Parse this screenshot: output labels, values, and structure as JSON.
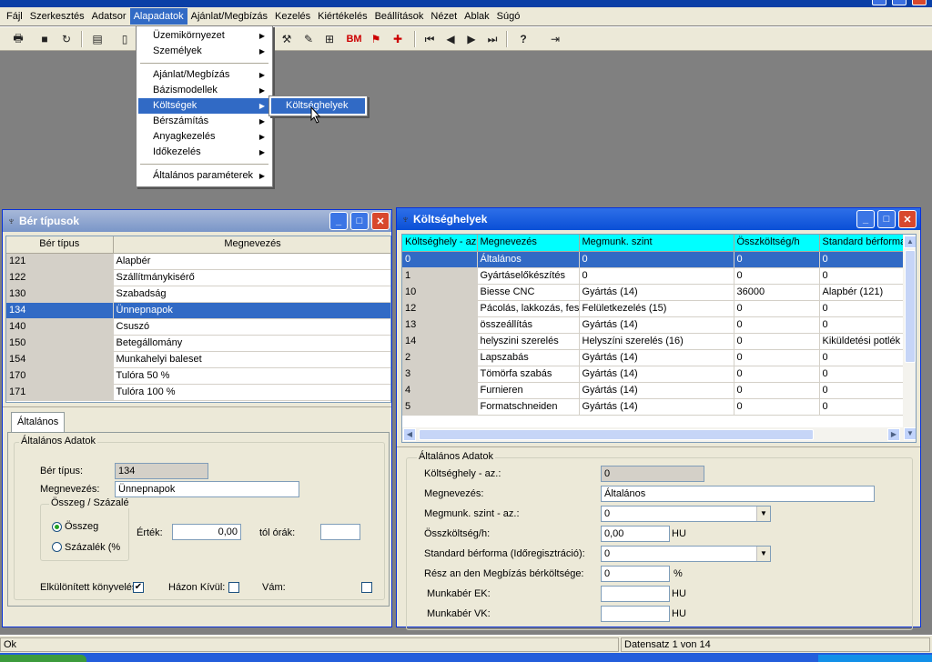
{
  "app": {
    "window_buttons": [
      "_",
      "□",
      "✕"
    ]
  },
  "menubar": {
    "items": [
      "Fájl",
      "Szerkesztés",
      "Adatsor",
      "Alapadatok",
      "Ajánlat/Megbízás",
      "Kezelés",
      "Kiértékelés",
      "Beállítások",
      "Nézet",
      "Ablak",
      "Súgó"
    ],
    "active": "Alapadatok"
  },
  "toolbar": {
    "icons": [
      "printer-icon",
      "save-icon",
      "refresh-icon",
      "list-icon",
      "new-document-icon",
      "wrench-icon",
      "form-icon",
      "org-chart-icon",
      "bm-icon",
      "chart-icon",
      "tools-icon",
      "first-record-icon",
      "previous-record-icon",
      "next-record-icon",
      "last-record-icon",
      "help-icon",
      "exit-icon"
    ],
    "bm_label": "BM"
  },
  "dropdown": {
    "items": [
      "Üzemikörnyezet",
      "Személyek",
      "Ajánlat/Megbízás",
      "Bázismodellek",
      "Költségek",
      "Bérszámítás",
      "Anyagkezelés",
      "Időkezelés",
      "Általános paraméterek"
    ],
    "active": "Költségek",
    "submenu": [
      "Költséghelyek"
    ]
  },
  "ber_window": {
    "title": "Bér típusok",
    "columns": [
      "Bér típus",
      "Megnevezés"
    ],
    "rows": [
      [
        "121",
        "Alapbér"
      ],
      [
        "122",
        "Szállítmánykisérő"
      ],
      [
        "130",
        "Szabadság"
      ],
      [
        "134",
        "Ünnepnapok"
      ],
      [
        "140",
        "Csuszó"
      ],
      [
        "150",
        "Betegállomány"
      ],
      [
        "154",
        "Munkahelyi baleset"
      ],
      [
        "170",
        "Tulóra  50 %"
      ],
      [
        "171",
        "Tulóra 100 %"
      ]
    ],
    "selected_row": 3,
    "tab": "Általános",
    "group": "Általános Adatok",
    "fields": {
      "ber_tipus_label": "Bér típus:",
      "ber_tipus_value": "134",
      "megnevezes_label": "Megnevezés:",
      "megnevezes_value": "Ünnepnapok",
      "osszeg_group": "Összeg / Százalé",
      "osszeg_label": "Összeg",
      "szazalek_label": "Százalék (%",
      "ertek_label": "Érték:",
      "ertek_value": "0,00",
      "tol_orak_label": "tól órák:",
      "tol_orak_value": "",
      "elkulonitett_label": "Elkülönített könyvelés",
      "elkulonitett_checked": "✔",
      "hazon_kivul_label": "Házon Kívül:",
      "vam_label": "Vám:"
    }
  },
  "koltseg_window": {
    "title": "Költséghelyek",
    "columns": [
      "Költséghely - az.",
      "Megnevezés",
      "Megmunk. szint",
      "Összköltség/h",
      "Standard bérforma"
    ],
    "rows": [
      [
        "0",
        "Általános",
        "0",
        "0",
        "0"
      ],
      [
        "1",
        "Gyártáselőkészítés",
        "0",
        "0",
        "0"
      ],
      [
        "10",
        "Biesse CNC",
        "Gyártás (14)",
        "36000",
        "Alapbér (121)"
      ],
      [
        "12",
        "Pácolás, lakkozás, festés",
        "Felületkezelés (15)",
        "0",
        "0"
      ],
      [
        "13",
        "összeállítás",
        "Gyártás (14)",
        "0",
        "0"
      ],
      [
        "14",
        "helyszini szerelés",
        "Helyszíni szerelés (16)",
        "0",
        "Kiküldetési potlék"
      ],
      [
        "2",
        "Lapszabás",
        "Gyártás (14)",
        "0",
        "0"
      ],
      [
        "3",
        "Tömörfa szabás",
        "Gyártás (14)",
        "0",
        "0"
      ],
      [
        "4",
        "Furnieren",
        "Gyártás (14)",
        "0",
        "0"
      ],
      [
        "5",
        "Formatschneiden",
        "Gyártás (14)",
        "0",
        "0"
      ]
    ],
    "selected_row": 0,
    "group": "Általános Adatok",
    "fields": {
      "kh_label": "Költséghely - az.:",
      "kh_value": "0",
      "megnev_label": "Megnevezés:",
      "megnev_value": "Általános",
      "szint_label": "Megmunk. szint - az.:",
      "szint_value": "0",
      "ossz_label": "Összköltség/h:",
      "ossz_value": "0,00",
      "ossz_unit": "HU",
      "std_label": "Standard bérforma (Időregisztráció):",
      "std_value": "0",
      "resz_label": "Rész an den Megbízás bérköltsége:",
      "resz_value": "0",
      "resz_unit": "%",
      "ek_label": "Munkabér EK:",
      "ek_unit": "HU",
      "vk_label": "Munkabér VK:",
      "vk_unit": "HU"
    }
  },
  "status": {
    "left": "Ok",
    "record": "Datensatz 1 von 14"
  }
}
